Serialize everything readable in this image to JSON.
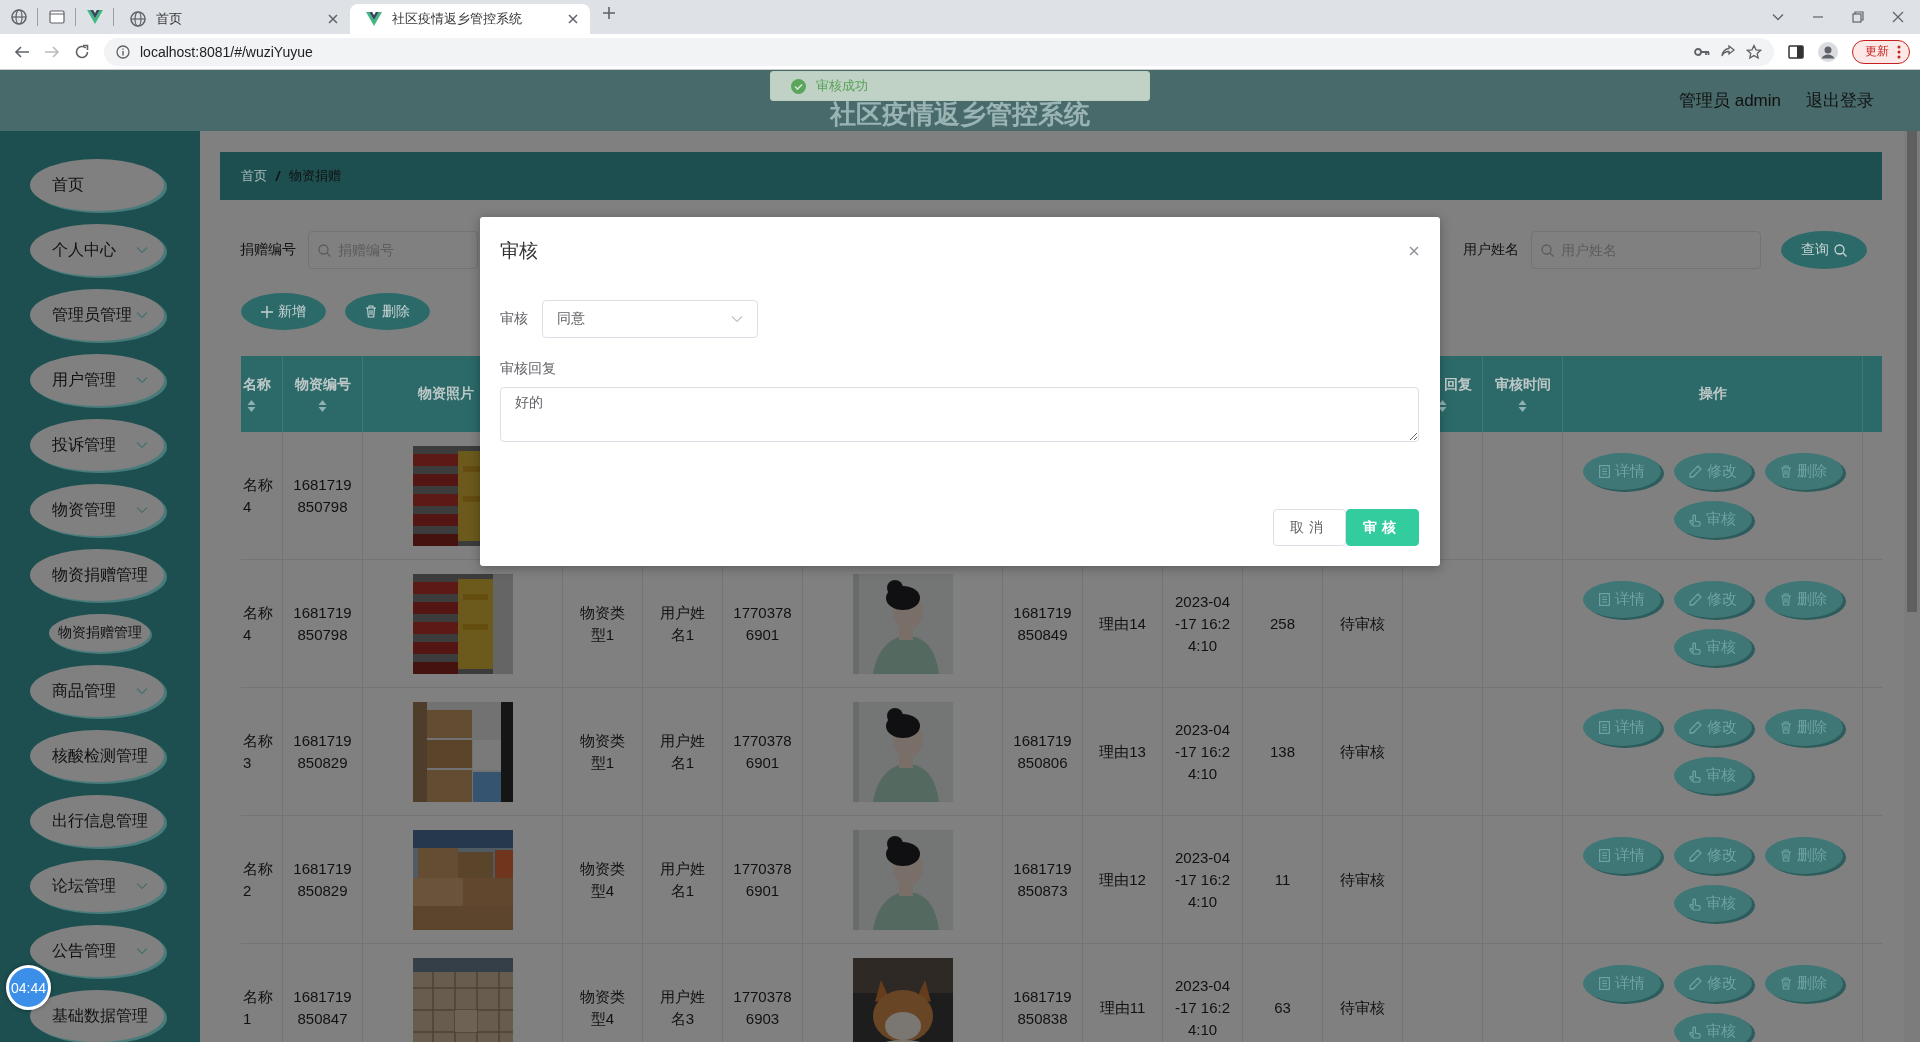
{
  "browser": {
    "tabs": [
      {
        "title": "首页",
        "selected": false
      },
      {
        "title": "社区疫情返乡管控系统",
        "selected": true
      }
    ],
    "url": "localhost:8081/#/wuziYuyue",
    "update_button": "更新"
  },
  "header": {
    "title": "社区疫情返乡管控系统",
    "user": "管理员 admin",
    "logout": "退出登录"
  },
  "toast": {
    "message": "审核成功"
  },
  "sidebar": {
    "items": [
      {
        "label": "首页",
        "expandable": false
      },
      {
        "label": "个人中心",
        "expandable": true
      },
      {
        "label": "管理员管理",
        "expandable": true
      },
      {
        "label": "用户管理",
        "expandable": true
      },
      {
        "label": "投诉管理",
        "expandable": true
      },
      {
        "label": "物资管理",
        "expandable": true
      },
      {
        "label": "物资捐赠管理",
        "expandable": false,
        "children": [
          {
            "label": "物资捐赠管理"
          }
        ]
      },
      {
        "label": "商品管理",
        "expandable": true
      },
      {
        "label": "核酸检测管理",
        "expandable": false
      },
      {
        "label": "出行信息管理",
        "expandable": false
      },
      {
        "label": "论坛管理",
        "expandable": true
      },
      {
        "label": "公告管理",
        "expandable": true
      },
      {
        "label": "基础数据管理",
        "expandable": false
      }
    ]
  },
  "timer": "04:44",
  "breadcrumb": [
    "首页",
    "物资捐赠"
  ],
  "search": {
    "fields": [
      {
        "label": "捐赠编号",
        "placeholder": "捐赠编号"
      },
      {
        "label": "用户姓名",
        "placeholder": "用户姓名"
      }
    ],
    "button": "查询"
  },
  "toolbar": [
    {
      "label": "新增",
      "kind": "add"
    },
    {
      "label": "删除",
      "kind": "delete"
    }
  ],
  "table": {
    "columns": [
      {
        "label": "名称",
        "sortable": true
      },
      {
        "label": "物资编号",
        "sortable": true
      },
      {
        "label": "物资照片",
        "sortable": false
      },
      null,
      null,
      null,
      null,
      null,
      null,
      null,
      null,
      null,
      {
        "label": "回复",
        "sortable": true
      },
      {
        "label": "审核时间",
        "sortable": true
      },
      {
        "label": "操作",
        "sortable": false
      }
    ],
    "rows": [
      {
        "cells": [
          "名称4",
          "1681719850798",
          {
            "kind": "picture"
          },
          null,
          null,
          null,
          null,
          null,
          null,
          null,
          null,
          null,
          null,
          null
        ],
        "actions": [
          {
            "label": "详情",
            "kind": "detail"
          },
          {
            "label": "修改",
            "kind": "edit"
          },
          {
            "label": "删除",
            "kind": "delete"
          },
          {
            "label": "审核",
            "kind": "review"
          }
        ]
      },
      {
        "cells": [
          "名称4",
          "1681719850798",
          {
            "kind": "picture"
          },
          "物资类型1",
          "用户姓名1",
          "17703786901",
          {
            "kind": "picture"
          },
          "1681719850849",
          "理由14",
          "2023-04-17 16:24:10",
          "258",
          "待审核",
          null,
          null
        ],
        "actions": [
          {
            "label": "详情",
            "kind": "detail"
          },
          {
            "label": "修改",
            "kind": "edit"
          },
          {
            "label": "删除",
            "kind": "delete"
          },
          {
            "label": "审核",
            "kind": "review"
          }
        ]
      },
      {
        "cells": [
          "名称3",
          "1681719850829",
          {
            "kind": "picture"
          },
          "物资类型1",
          "用户姓名1",
          "17703786901",
          {
            "kind": "picture"
          },
          "1681719850806",
          "理由13",
          "2023-04-17 16:24:10",
          "138",
          "待审核",
          null,
          null
        ],
        "actions": [
          {
            "label": "详情",
            "kind": "detail"
          },
          {
            "label": "修改",
            "kind": "edit"
          },
          {
            "label": "删除",
            "kind": "delete"
          },
          {
            "label": "审核",
            "kind": "review"
          }
        ]
      },
      {
        "cells": [
          "名称2",
          "1681719850829",
          {
            "kind": "picture"
          },
          "物资类型4",
          "用户姓名1",
          "17703786901",
          {
            "kind": "picture"
          },
          "1681719850873",
          "理由12",
          "2023-04-17 16:24:10",
          "11",
          "待审核",
          null,
          null
        ],
        "actions": [
          {
            "label": "详情",
            "kind": "detail"
          },
          {
            "label": "修改",
            "kind": "edit"
          },
          {
            "label": "删除",
            "kind": "delete"
          },
          {
            "label": "审核",
            "kind": "review"
          }
        ]
      },
      {
        "cells": [
          "名称1",
          "1681719850847",
          {
            "kind": "picture"
          },
          "物资类型4",
          "用户姓名3",
          "17703786903",
          {
            "kind": "picture"
          },
          "1681719850838",
          "理由11",
          "2023-04-17 16:24:10",
          "63",
          "待审核",
          null,
          null
        ],
        "actions": [
          {
            "label": "详情",
            "kind": "detail"
          },
          {
            "label": "修改",
            "kind": "edit"
          },
          {
            "label": "删除",
            "kind": "delete"
          },
          {
            "label": "审核",
            "kind": "review"
          }
        ]
      }
    ]
  },
  "dialog": {
    "title": "审核",
    "fields": [
      {
        "label": "审核",
        "kind": "select",
        "value": "同意"
      },
      {
        "label": "审核回复",
        "kind": "textarea",
        "value": "好的"
      }
    ],
    "buttons": [
      {
        "label": "取消",
        "kind": "secondary"
      },
      {
        "label": "审核",
        "kind": "primary"
      }
    ]
  }
}
